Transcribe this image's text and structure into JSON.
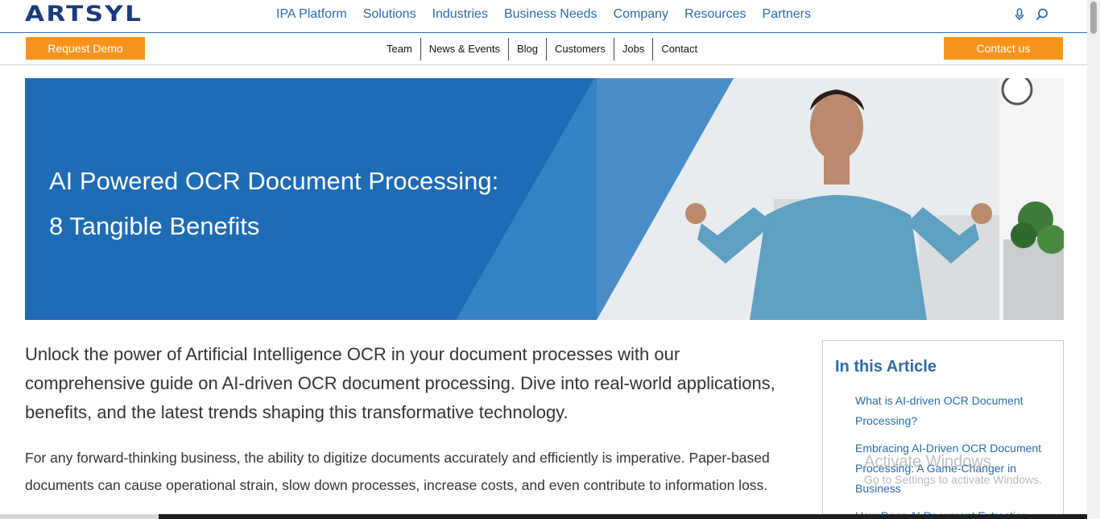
{
  "brand": {
    "logo_text": "ARTSYL"
  },
  "main_nav": [
    {
      "label": "IPA Platform"
    },
    {
      "label": "Solutions"
    },
    {
      "label": "Industries"
    },
    {
      "label": "Business Needs"
    },
    {
      "label": "Company"
    },
    {
      "label": "Resources"
    },
    {
      "label": "Partners"
    }
  ],
  "icons": {
    "mic": "microphone-icon",
    "search": "search-icon"
  },
  "subbar": {
    "request_demo": "Request Demo",
    "contact_us": "Contact us",
    "links": [
      {
        "label": "Team"
      },
      {
        "label": "News & Events"
      },
      {
        "label": "Blog"
      },
      {
        "label": "Customers"
      },
      {
        "label": "Jobs"
      },
      {
        "label": "Contact"
      }
    ]
  },
  "hero": {
    "title_line1": "AI Powered OCR Document Processing:",
    "title_line2": "8 Tangible Benefits"
  },
  "article": {
    "lead": "Unlock the power of Artificial Intelligence OCR in your document processes with our comprehensive guide on AI-driven OCR document processing. Dive into real-world applications, benefits, and the latest trends shaping this transformative technology.",
    "paragraph": "For any forward-thinking business, the ability to digitize documents accurately and efficiently is imperative. Paper-based documents can cause operational strain, slow down processes, increase costs, and even contribute to information loss."
  },
  "toc": {
    "heading": "In this Article",
    "items": [
      {
        "label": "What is AI-driven OCR Document Processing?"
      },
      {
        "label": "Embracing AI-Driven OCR Document Processing: A Game-Changer in Business"
      },
      {
        "label": "How Does AI Document Extraction"
      }
    ]
  },
  "watermark": {
    "line1": "Activate Windows",
    "line2": "Go to Settings to activate Windows."
  },
  "colors": {
    "brand_blue": "#1b3b78",
    "link_blue": "#2b6aa6",
    "hero_blue": "#1f6bb4",
    "orange": "#f7941d"
  }
}
